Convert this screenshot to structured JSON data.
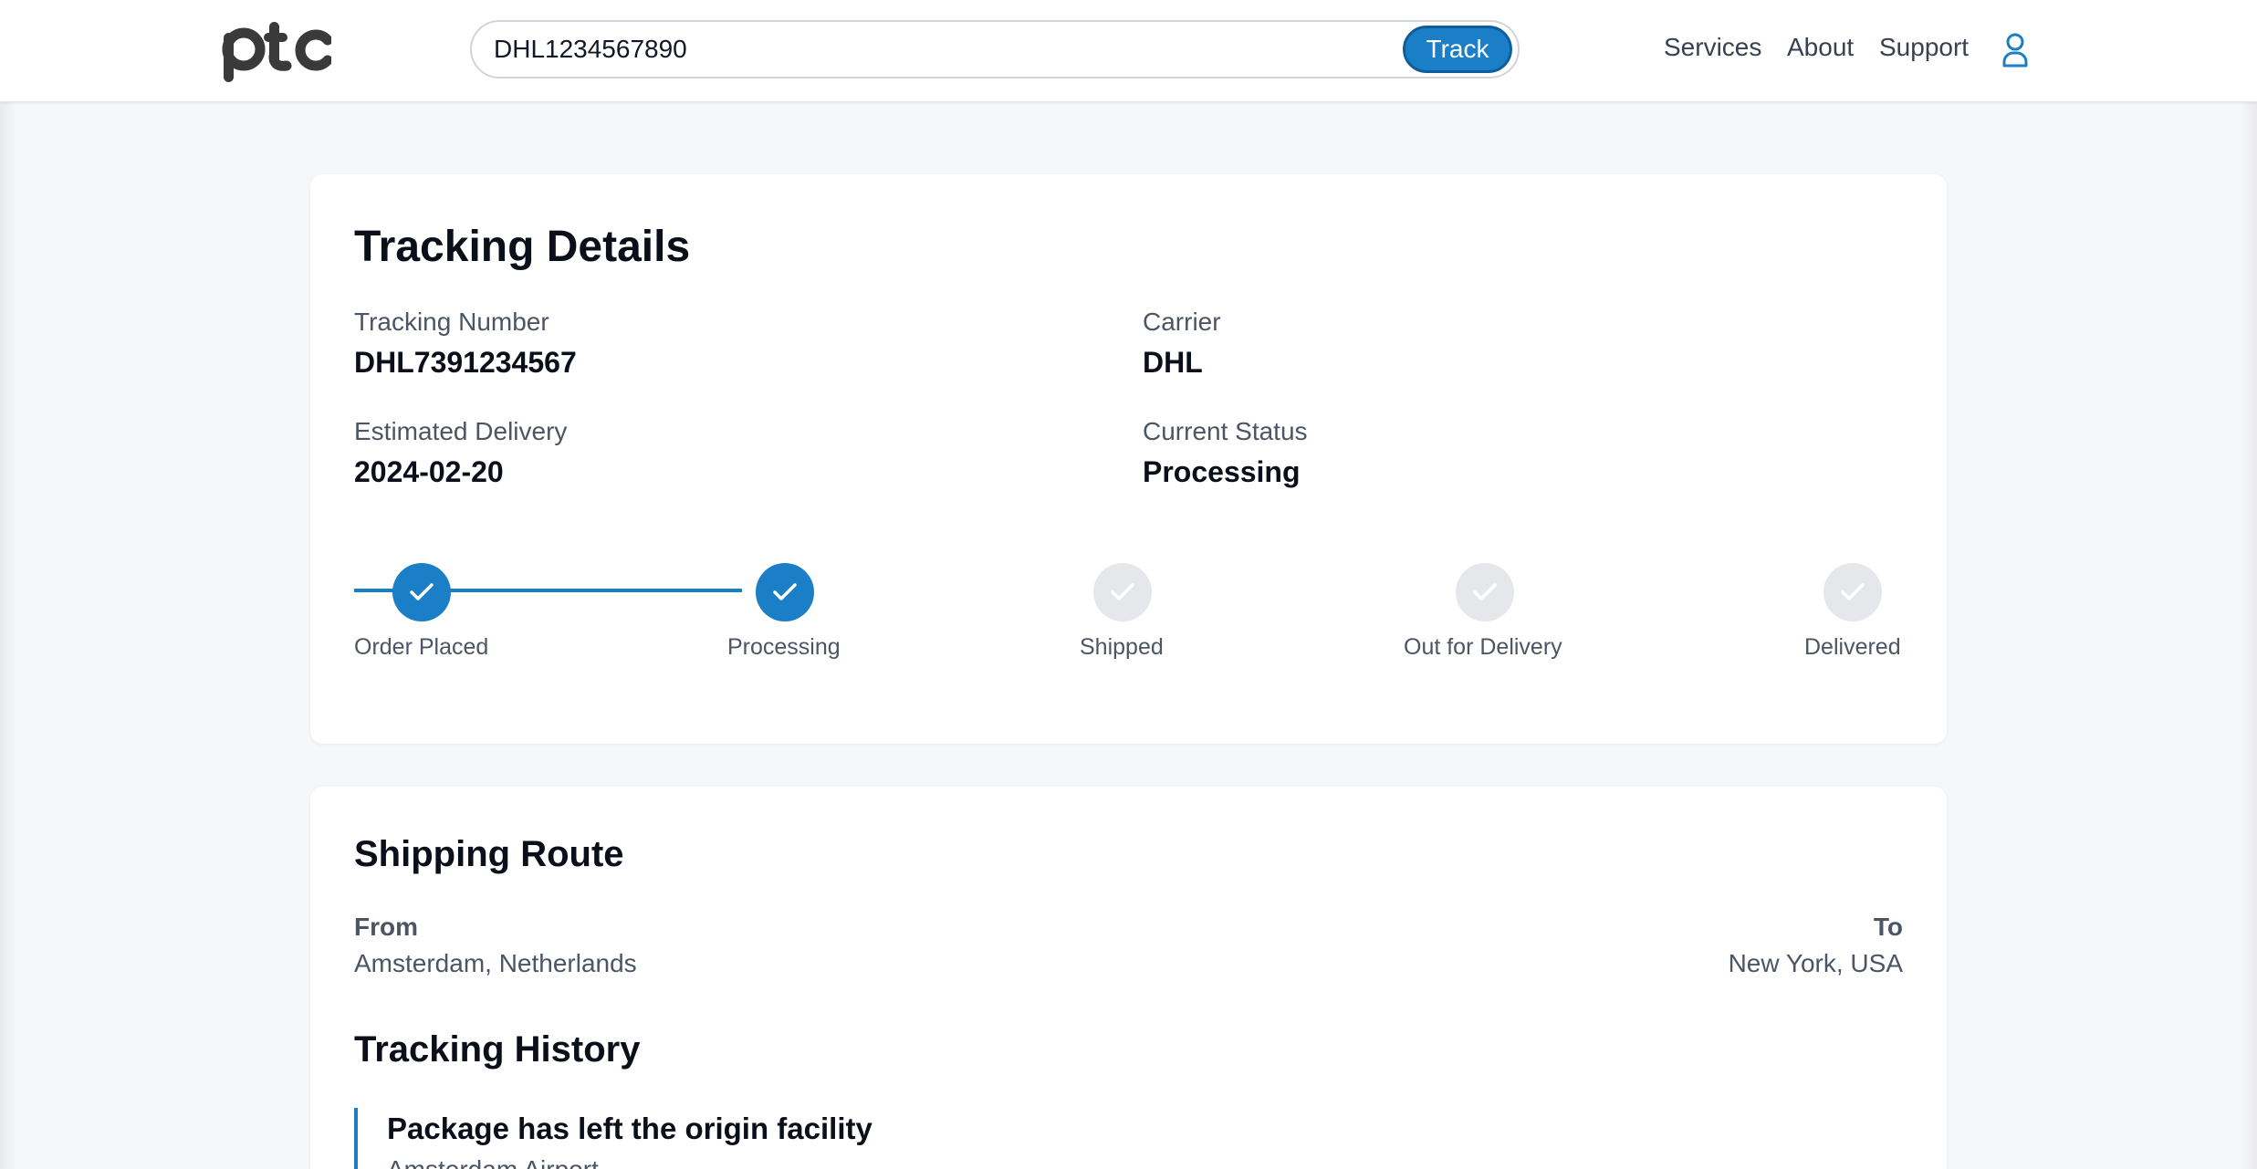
{
  "header": {
    "logo_text": "ptc",
    "search": {
      "value": "DHL1234567890",
      "button_label": "Track"
    },
    "nav": [
      "Services",
      "About",
      "Support"
    ],
    "user_icon": "user-icon"
  },
  "details": {
    "title": "Tracking Details",
    "tracking_number_label": "Tracking Number",
    "tracking_number_value": "DHL7391234567",
    "carrier_label": "Carrier",
    "carrier_value": "DHL",
    "estimated_delivery_label": "Estimated Delivery",
    "estimated_delivery_value": "2024-02-20",
    "current_status_label": "Current Status",
    "current_status_value": "Processing",
    "steps": [
      {
        "label": "Order Placed",
        "done": true
      },
      {
        "label": "Processing",
        "done": true
      },
      {
        "label": "Shipped",
        "done": false
      },
      {
        "label": "Out for Delivery",
        "done": false
      },
      {
        "label": "Delivered",
        "done": false
      }
    ]
  },
  "route": {
    "title": "Shipping Route",
    "from_label": "From",
    "from_value": "Amsterdam, Netherlands",
    "to_label": "To",
    "to_value": "New York, USA"
  },
  "history": {
    "title": "Tracking History",
    "items": [
      {
        "event": "Package has left the origin facility",
        "location": "Amsterdam Airport"
      }
    ]
  },
  "colors": {
    "accent": "#1a7fc6",
    "step_pending": "#e5e7eb",
    "background": "#f6f7f9"
  }
}
